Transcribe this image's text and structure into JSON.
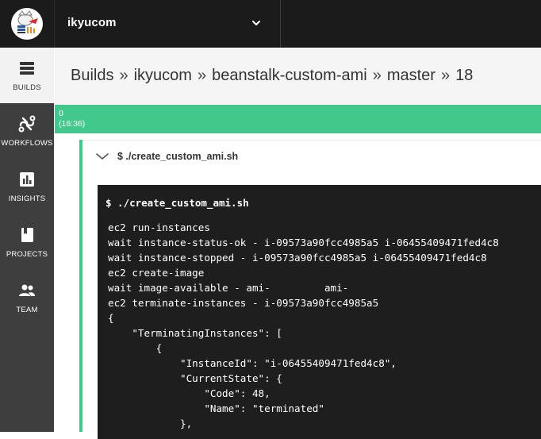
{
  "topbar": {
    "org_name": "ikyucom"
  },
  "sidebar": {
    "items": [
      {
        "label": "BUILDS",
        "icon": "builds-icon",
        "active": true
      },
      {
        "label": "WORKFLOWS",
        "icon": "workflows-icon",
        "active": false
      },
      {
        "label": "INSIGHTS",
        "icon": "insights-icon",
        "active": false
      },
      {
        "label": "PROJECTS",
        "icon": "projects-icon",
        "active": false
      },
      {
        "label": "TEAM",
        "icon": "team-icon",
        "active": false
      }
    ]
  },
  "breadcrumb": {
    "items": [
      "Builds",
      "ikyucom",
      "beanstalk-custom-ami",
      "master",
      "18"
    ],
    "separator": "»"
  },
  "status": {
    "line1": "0",
    "line2": "(16:36)",
    "color": "#42c88a"
  },
  "step": {
    "title": "$ ./create_custom_ami.sh",
    "terminal": {
      "command": "$ ./create_custom_ami.sh",
      "lines": [
        "ec2 run-instances",
        "wait instance-status-ok - i-09573a90fcc4985a5 i-06455409471fed4c8",
        "wait instance-stopped - i-09573a90fcc4985a5 i-06455409471fed4c8",
        "ec2 create-image",
        "wait image-available - ami-         ami-",
        "ec2 terminate-instances - i-09573a90fcc4985a5",
        "{",
        "    \"TerminatingInstances\": [",
        "        {",
        "            \"InstanceId\": \"i-06455409471fed4c8\",",
        "            \"CurrentState\": {",
        "                \"Code\": 48,",
        "                \"Name\": \"terminated\"",
        "            },"
      ]
    }
  },
  "colors": {
    "topbar": "#1b1b1b",
    "sidebar": "#3e3e3e",
    "accent_green": "#42c88a",
    "terminal_bg": "#1e1e1e"
  }
}
